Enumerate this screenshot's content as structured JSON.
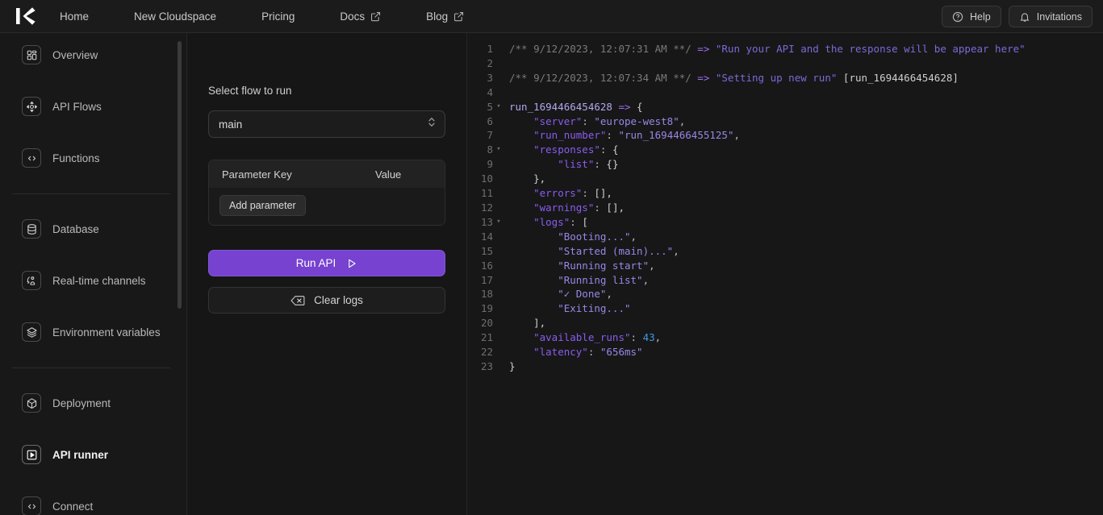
{
  "brand": {
    "logo_alt": "K"
  },
  "topnav": {
    "items": [
      {
        "label": "Home",
        "external": false
      },
      {
        "label": "New Cloudspace",
        "external": false
      },
      {
        "label": "Pricing",
        "external": false
      },
      {
        "label": "Docs",
        "external": true
      },
      {
        "label": "Blog",
        "external": true
      }
    ],
    "help_label": "Help",
    "invitations_label": "Invitations"
  },
  "sidebar": {
    "items": [
      {
        "label": "Overview",
        "icon": "grid-icon",
        "active": false
      },
      {
        "label": "API Flows",
        "icon": "move-arrows-icon",
        "active": false
      },
      {
        "label": "Functions",
        "icon": "code-brackets-icon",
        "active": false
      },
      {
        "label": "Database",
        "icon": "database-icon",
        "active": false
      },
      {
        "label": "Real-time channels",
        "icon": "realtime-channels-icon",
        "active": false
      },
      {
        "label": "Environment variables",
        "icon": "layers-icon",
        "active": false
      },
      {
        "label": "Deployment",
        "icon": "cube-icon",
        "active": false
      },
      {
        "label": "API runner",
        "icon": "play-box-icon",
        "active": true
      },
      {
        "label": "Connect",
        "icon": "code-brackets-icon",
        "active": false
      }
    ]
  },
  "panel": {
    "flow_label": "Select flow to run",
    "flow_value": "main",
    "param_header": {
      "key": "Parameter Key",
      "value": "Value"
    },
    "add_parameter_label": "Add parameter",
    "run_api_label": "Run API",
    "clear_logs_label": "Clear logs",
    "accent_color": "#7642cf"
  },
  "console": {
    "lines": [
      {
        "n": 1,
        "fold": false,
        "tokens": [
          {
            "t": "/** 9/12/2023, 12:07:31 AM **/ ",
            "c": "c-comment"
          },
          {
            "t": "=> ",
            "c": "c-arrow"
          },
          {
            "t": "\"Run your API and the response will be appear here\"",
            "c": "c-str"
          }
        ]
      },
      {
        "n": 2,
        "fold": false,
        "tokens": []
      },
      {
        "n": 3,
        "fold": false,
        "tokens": [
          {
            "t": "/** 9/12/2023, 12:07:34 AM **/ ",
            "c": "c-comment"
          },
          {
            "t": "=> ",
            "c": "c-arrow"
          },
          {
            "t": "\"Setting up new run\"",
            "c": "c-str"
          },
          {
            "t": " [run_1694466454628]",
            "c": "c-brk"
          }
        ]
      },
      {
        "n": 4,
        "fold": false,
        "tokens": []
      },
      {
        "n": 5,
        "fold": true,
        "tokens": [
          {
            "t": "run_1694466454628",
            "c": "c-plain"
          },
          {
            "t": " => ",
            "c": "c-arrow"
          },
          {
            "t": "{",
            "c": "c-brk"
          }
        ]
      },
      {
        "n": 6,
        "fold": false,
        "tokens": [
          {
            "t": "    \"server\"",
            "c": "c-key"
          },
          {
            "t": ": ",
            "c": "c-punct"
          },
          {
            "t": "\"europe-west8\"",
            "c": "c-strlit"
          },
          {
            "t": ",",
            "c": "c-punct"
          }
        ]
      },
      {
        "n": 7,
        "fold": false,
        "tokens": [
          {
            "t": "    \"run_number\"",
            "c": "c-key"
          },
          {
            "t": ": ",
            "c": "c-punct"
          },
          {
            "t": "\"run_1694466455125\"",
            "c": "c-strlit"
          },
          {
            "t": ",",
            "c": "c-punct"
          }
        ]
      },
      {
        "n": 8,
        "fold": true,
        "tokens": [
          {
            "t": "    \"responses\"",
            "c": "c-key"
          },
          {
            "t": ": ",
            "c": "c-punct"
          },
          {
            "t": "{",
            "c": "c-brk"
          }
        ]
      },
      {
        "n": 9,
        "fold": false,
        "tokens": [
          {
            "t": "        \"list\"",
            "c": "c-key"
          },
          {
            "t": ": ",
            "c": "c-punct"
          },
          {
            "t": "{}",
            "c": "c-brk"
          }
        ]
      },
      {
        "n": 10,
        "fold": false,
        "tokens": [
          {
            "t": "    },",
            "c": "c-brk"
          }
        ]
      },
      {
        "n": 11,
        "fold": false,
        "tokens": [
          {
            "t": "    \"errors\"",
            "c": "c-key"
          },
          {
            "t": ": ",
            "c": "c-punct"
          },
          {
            "t": "[],",
            "c": "c-brk"
          }
        ]
      },
      {
        "n": 12,
        "fold": false,
        "tokens": [
          {
            "t": "    \"warnings\"",
            "c": "c-key"
          },
          {
            "t": ": ",
            "c": "c-punct"
          },
          {
            "t": "[],",
            "c": "c-brk"
          }
        ]
      },
      {
        "n": 13,
        "fold": true,
        "tokens": [
          {
            "t": "    \"logs\"",
            "c": "c-key"
          },
          {
            "t": ": ",
            "c": "c-punct"
          },
          {
            "t": "[",
            "c": "c-brk"
          }
        ]
      },
      {
        "n": 14,
        "fold": false,
        "tokens": [
          {
            "t": "        \"Booting...\"",
            "c": "c-strlit"
          },
          {
            "t": ",",
            "c": "c-punct"
          }
        ]
      },
      {
        "n": 15,
        "fold": false,
        "tokens": [
          {
            "t": "        \"Started (main)...\"",
            "c": "c-strlit"
          },
          {
            "t": ",",
            "c": "c-punct"
          }
        ]
      },
      {
        "n": 16,
        "fold": false,
        "tokens": [
          {
            "t": "        \"Running start\"",
            "c": "c-strlit"
          },
          {
            "t": ",",
            "c": "c-punct"
          }
        ]
      },
      {
        "n": 17,
        "fold": false,
        "tokens": [
          {
            "t": "        \"Running list\"",
            "c": "c-strlit"
          },
          {
            "t": ",",
            "c": "c-punct"
          }
        ]
      },
      {
        "n": 18,
        "fold": false,
        "tokens": [
          {
            "t": "        \"✓ Done\"",
            "c": "c-strlit"
          },
          {
            "t": ",",
            "c": "c-punct"
          }
        ]
      },
      {
        "n": 19,
        "fold": false,
        "tokens": [
          {
            "t": "        \"Exiting...\"",
            "c": "c-strlit"
          }
        ]
      },
      {
        "n": 20,
        "fold": false,
        "tokens": [
          {
            "t": "    ],",
            "c": "c-brk"
          }
        ]
      },
      {
        "n": 21,
        "fold": false,
        "tokens": [
          {
            "t": "    \"available_runs\"",
            "c": "c-key"
          },
          {
            "t": ": ",
            "c": "c-punct"
          },
          {
            "t": "43",
            "c": "c-num"
          },
          {
            "t": ",",
            "c": "c-punct"
          }
        ]
      },
      {
        "n": 22,
        "fold": false,
        "tokens": [
          {
            "t": "    \"latency\"",
            "c": "c-key"
          },
          {
            "t": ": ",
            "c": "c-punct"
          },
          {
            "t": "\"656ms\"",
            "c": "c-strlit"
          }
        ]
      },
      {
        "n": 23,
        "fold": false,
        "tokens": [
          {
            "t": "}",
            "c": "c-brk"
          }
        ]
      }
    ]
  }
}
